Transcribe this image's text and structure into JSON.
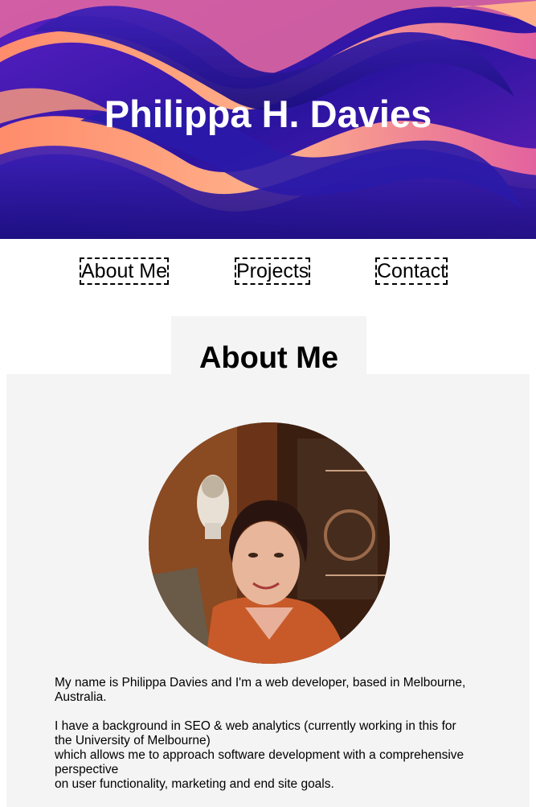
{
  "header": {
    "title": "Philippa H. Davies"
  },
  "nav": {
    "items": [
      {
        "label": "About Me"
      },
      {
        "label": "Projects"
      },
      {
        "label": "Contact"
      }
    ]
  },
  "about": {
    "heading": "About Me",
    "photo_icon": "portrait-photo",
    "bio_line1": "My name is Philippa Davies and I'm a web developer, based in Melbourne,",
    "bio_line2": "Australia.",
    "bio_line3": "I have a background in SEO & web analytics (currently working in this for",
    "bio_line4": "the University of Melbourne)",
    "bio_line5": "which allows me to approach software development with a comprehensive",
    "bio_line6": "perspective",
    "bio_line7": "on user functionality, marketing and end site goals."
  },
  "colors": {
    "hero_background": "#3b1a9e",
    "panel_background": "#f4f4f4",
    "text": "#000000"
  }
}
